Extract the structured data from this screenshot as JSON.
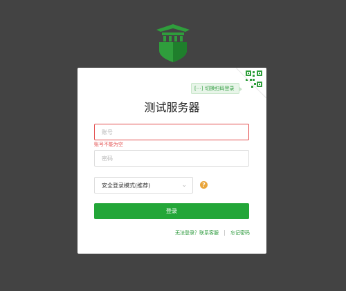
{
  "header": {
    "logo_icon": "castle-gate-shield-icon"
  },
  "card": {
    "title": "测试服务器",
    "qr_switch_label": "切换扫码登录",
    "qr_icon": "qr-code-icon",
    "account_placeholder": "账号",
    "account_error": "账号不能为空",
    "password_placeholder": "密码",
    "login_mode_value": "安全登录模式(推荐)",
    "help_icon": "question-circle-icon",
    "login_button_label": "登录",
    "links": {
      "cannot_login": "无法登录？联系客服",
      "forgot_password": "忘记密码"
    }
  },
  "colors": {
    "background": "#434343",
    "accent": "#23a638",
    "error": "#e34d4d",
    "help": "#e9a53a"
  }
}
